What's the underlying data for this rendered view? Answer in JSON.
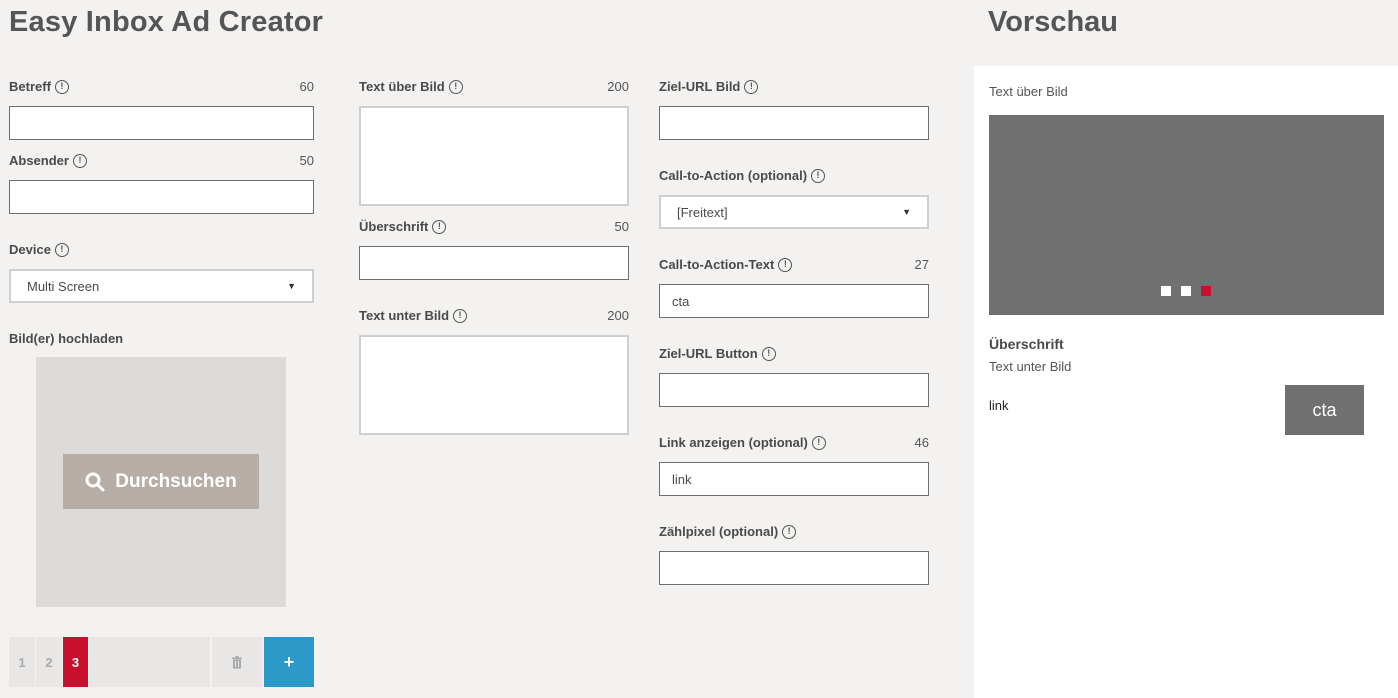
{
  "header": {
    "title": "Easy Inbox Ad Creator"
  },
  "preview_header": {
    "title": "Vorschau"
  },
  "col1": {
    "betreff": {
      "label": "Betreff",
      "counter": "60",
      "value": ""
    },
    "absender": {
      "label": "Absender",
      "counter": "50",
      "value": ""
    },
    "device": {
      "label": "Device",
      "selected": "Multi Screen"
    },
    "upload": {
      "label": "Bild(er) hochladen",
      "button": "Durchsuchen"
    },
    "pager": {
      "pages": [
        "1",
        "2",
        "3"
      ],
      "active": "3",
      "add": "+"
    }
  },
  "col2": {
    "text_ueber": {
      "label": "Text über Bild",
      "counter": "200"
    },
    "ueberschrift": {
      "label": "Überschrift",
      "counter": "50"
    },
    "text_unter": {
      "label": "Text unter Bild",
      "counter": "200"
    }
  },
  "col3": {
    "ziel_url_bild": {
      "label": "Ziel-URL Bild"
    },
    "cta": {
      "label": "Call-to-Action (optional)",
      "selected": "[Freitext]"
    },
    "cta_text": {
      "label": "Call-to-Action-Text",
      "counter": "27",
      "value": "cta"
    },
    "ziel_url_button": {
      "label": "Ziel-URL Button"
    },
    "link": {
      "label": "Link anzeigen (optional)",
      "counter": "46",
      "value": "link"
    },
    "pixel": {
      "label": "Zählpixel (optional)"
    }
  },
  "preview": {
    "text_ueber": "Text über Bild",
    "heading": "Überschrift",
    "text_unter": "Text unter Bild",
    "link": "link",
    "cta": "cta",
    "slide_count": 3,
    "active_slide": 3
  },
  "colors": {
    "background": "#f3f2f0",
    "accent_red": "#c8102e",
    "add_blue": "#2c9ac8",
    "browse_button": "#b6aea6",
    "preview_image": "#707070"
  },
  "icons": {
    "info": "info-icon",
    "search": "search-icon",
    "trash": "trash-icon",
    "dropdown": "chevron-down-icon"
  }
}
